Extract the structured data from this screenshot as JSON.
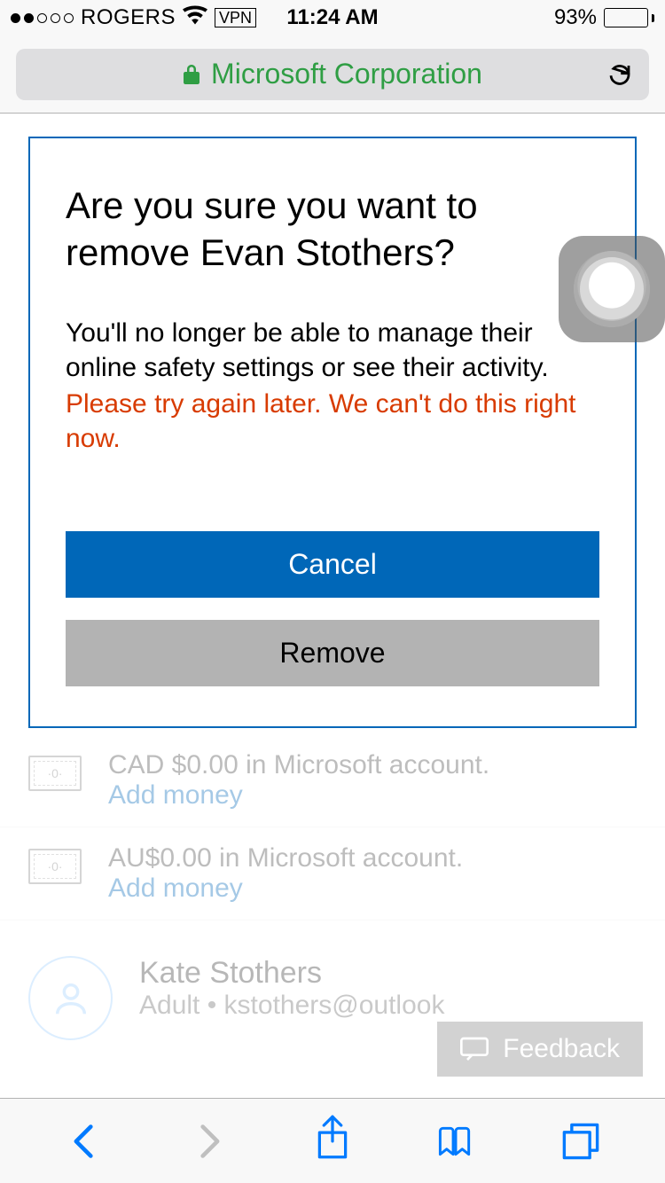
{
  "status_bar": {
    "carrier": "ROGERS",
    "vpn": "VPN",
    "time": "11:24 AM",
    "battery_pct": "93%"
  },
  "nav": {
    "site_label": "Microsoft Corporation"
  },
  "modal": {
    "title": "Are you sure you want to remove Evan Stothers?",
    "body": "You'll no longer be able to manage their online safety settings or see their activity.",
    "error": "Please try again later. We can't do this right now.",
    "cancel": "Cancel",
    "remove": "Remove"
  },
  "background": {
    "balance1": "CAD $0.00 in Microsoft account.",
    "balance2": "AU$0.00 in Microsoft account.",
    "add_money": "Add money",
    "profile_name": "Kate Stothers",
    "profile_sub": "Adult • kstothers@outlook"
  },
  "feedback": {
    "label": "Feedback"
  }
}
